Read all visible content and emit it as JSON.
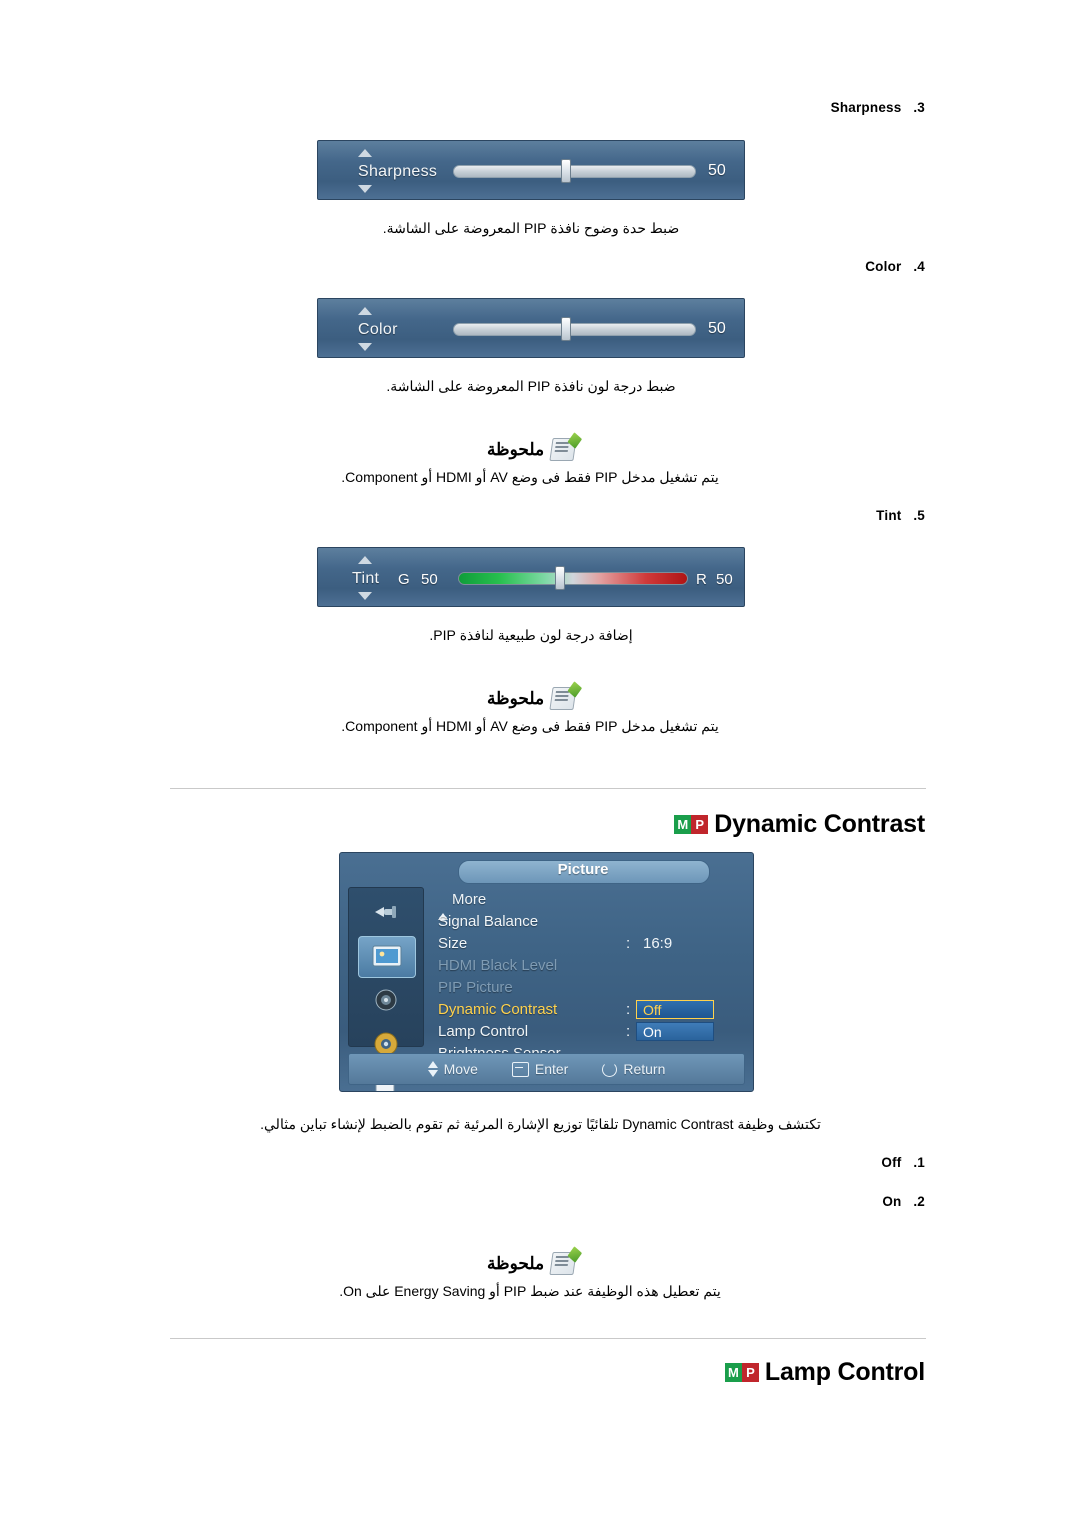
{
  "items": {
    "sharpness": {
      "index": ".3",
      "label": "Sharpness",
      "osd_label": "Sharpness",
      "value": "50",
      "caption": "ضبط حدة وضوح نافذة PIP المعروضة على الشاشة."
    },
    "color": {
      "index": ".4",
      "label": "Color",
      "osd_label": "Color",
      "value": "50",
      "caption": "ضبط درجة لون نافذة PIP المعروضة على الشاشة."
    },
    "tint": {
      "index": ".5",
      "label": "Tint",
      "osd_label": "Tint",
      "g_letter": "G",
      "g_value": "50",
      "r_letter": "R",
      "r_value": "50",
      "caption": "إضافة درجة لون طبيعية لنافذة PIP."
    }
  },
  "notes": {
    "title": "ملحوظة",
    "note1": "يتم تشغيل مدخل PIP فقط فى وضع AV أو HDMI أو Component.",
    "note2": "يتم تشغيل مدخل PIP فقط فى وضع AV أو HDMI أو Component.",
    "note3": "يتم تعطيل هذه الوظيفة عند ضبط PIP أو Energy Saving على On."
  },
  "sections": {
    "dynamic_contrast": {
      "badge_m": "M",
      "badge_p": "P",
      "title": "Dynamic Contrast",
      "description": "تكتشف وظيفة Dynamic Contrast تلقائيًا توزيع الإشارة المرئية ثم تقوم بالضبط لإنشاء تباين مثالي.",
      "options": [
        {
          "index": ".1",
          "label": "Off"
        },
        {
          "index": ".2",
          "label": "On"
        }
      ]
    },
    "lamp_control": {
      "badge_m": "M",
      "badge_p": "P",
      "title": "Lamp Control"
    }
  },
  "osd_menu": {
    "title": "Picture",
    "rows": [
      {
        "label": "More",
        "value": "",
        "state": "more"
      },
      {
        "label": "Signal Balance",
        "value": "",
        "state": "normal"
      },
      {
        "label": "Size",
        "value": "16:9",
        "state": "normal"
      },
      {
        "label": "HDMI Black Level",
        "value": "",
        "state": "dim"
      },
      {
        "label": "PIP Picture",
        "value": "",
        "state": "dim"
      },
      {
        "label": "Dynamic Contrast",
        "value": "Off",
        "state": "highlight"
      },
      {
        "label": "Lamp Control",
        "value": "On",
        "state": "normal"
      },
      {
        "label": "Brightness Sensor",
        "value": "",
        "state": "normal"
      }
    ],
    "footer": {
      "move": "Move",
      "enter": "Enter",
      "return": "Return"
    }
  }
}
